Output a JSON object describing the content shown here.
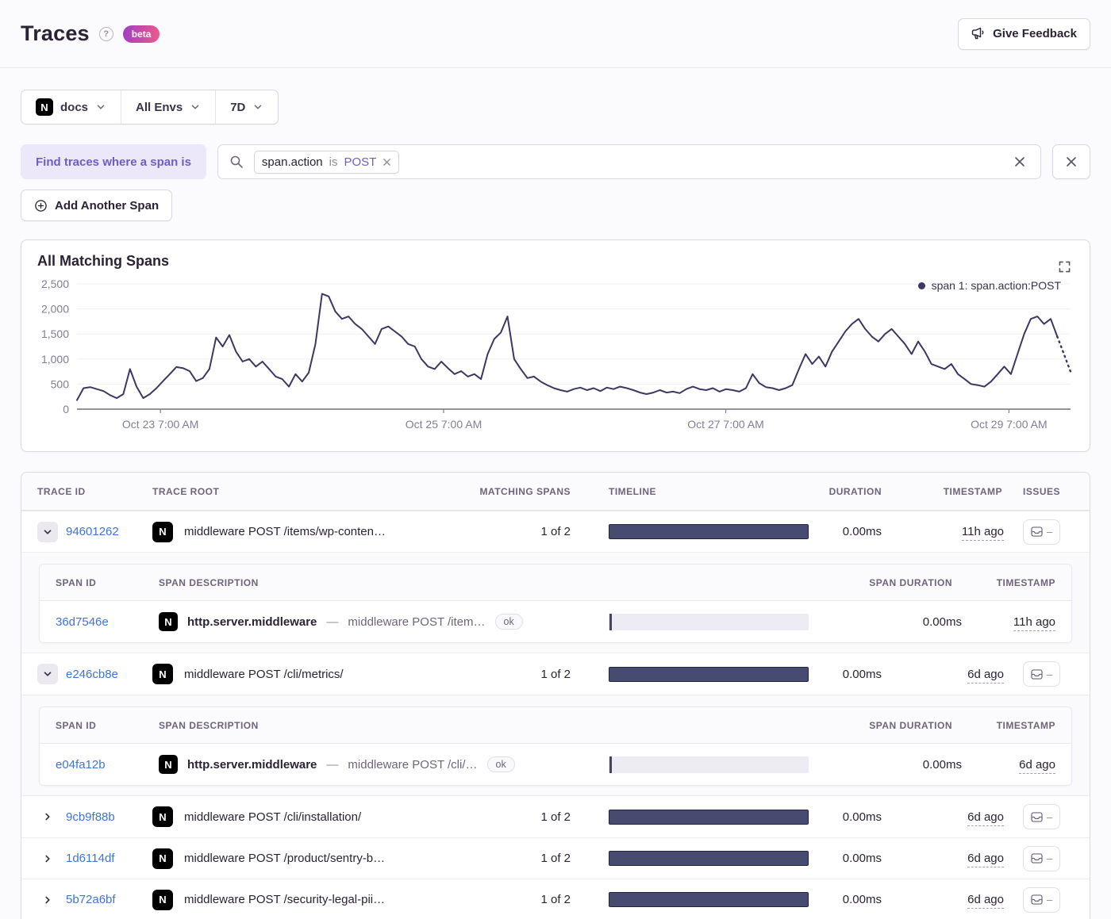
{
  "header": {
    "title": "Traces",
    "beta_label": "beta",
    "feedback_label": "Give Feedback"
  },
  "filters": {
    "project": "docs",
    "environment": "All Envs",
    "date_range": "7D"
  },
  "span_filter": {
    "label": "Find traces where a span is",
    "token_key": "span.action",
    "token_op": "is",
    "token_value": "POST",
    "add_button": "Add Another Span"
  },
  "chart": {
    "title": "All Matching Spans",
    "legend": "span 1: span.action:POST"
  },
  "chart_data": {
    "type": "line",
    "title": "All Matching Spans",
    "legend_position": "top-right",
    "grid": true,
    "line_color": "#3B3861",
    "ylim": [
      0,
      2500
    ],
    "y_ticks": [
      "0",
      "500",
      "1,000",
      "1,500",
      "2,000",
      "2,500"
    ],
    "x_ticks": [
      {
        "label": "Oct 23 7:00 AM",
        "pos": 0.084
      },
      {
        "label": "Oct 25 7:00 AM",
        "pos": 0.369
      },
      {
        "label": "Oct 27 7:00 AM",
        "pos": 0.653
      },
      {
        "label": "Oct 29 7:00 AM",
        "pos": 0.938
      }
    ],
    "dashed_tail_from": 148,
    "series": [
      {
        "name": "span 1: span.action:POST",
        "values": [
          180,
          420,
          440,
          400,
          360,
          280,
          220,
          300,
          800,
          450,
          220,
          300,
          420,
          560,
          700,
          840,
          820,
          760,
          560,
          620,
          800,
          1430,
          1250,
          1480,
          1150,
          950,
          1000,
          850,
          950,
          800,
          650,
          600,
          450,
          700,
          550,
          730,
          1300,
          2300,
          2250,
          1950,
          1800,
          1850,
          1700,
          1600,
          1450,
          1300,
          1600,
          1650,
          1550,
          1450,
          1300,
          1250,
          1000,
          850,
          800,
          950,
          820,
          700,
          760,
          650,
          700,
          600,
          1100,
          1400,
          1530,
          1850,
          1000,
          800,
          620,
          650,
          550,
          480,
          420,
          380,
          350,
          400,
          430,
          380,
          420,
          360,
          430,
          400,
          450,
          420,
          380,
          330,
          300,
          330,
          380,
          330,
          350,
          320,
          400,
          450,
          400,
          380,
          420,
          350,
          400,
          380,
          350,
          420,
          700,
          520,
          440,
          420,
          380,
          420,
          480,
          800,
          1100,
          900,
          1050,
          850,
          1150,
          1350,
          1550,
          1700,
          1800,
          1600,
          1450,
          1350,
          1500,
          1600,
          1450,
          1300,
          1100,
          1350,
          1150,
          900,
          850,
          800,
          900,
          700,
          600,
          500,
          480,
          450,
          550,
          700,
          850,
          700,
          1100,
          1500,
          1800,
          1850,
          1700,
          1800,
          1450,
          1100,
          750
        ]
      }
    ]
  },
  "table": {
    "columns": [
      "TRACE ID",
      "TRACE ROOT",
      "MATCHING SPANS",
      "TIMELINE",
      "DURATION",
      "TIMESTAMP",
      "ISSUES"
    ],
    "span_columns": {
      "id": "SPAN ID",
      "description": "SPAN DESCRIPTION",
      "duration": "SPAN DURATION",
      "timestamp": "TIMESTAMP"
    },
    "rows": [
      {
        "trace_id": "94601262",
        "trace_root": "middleware POST /items/wp-conten…",
        "matching_spans": "1 of 2",
        "duration": "0.00ms",
        "timestamp": "11h ago",
        "issues": "–",
        "expanded": true,
        "spans": [
          {
            "span_id": "36d7546e",
            "op": "http.server.middleware",
            "separator": "—",
            "description": "middleware POST /item…",
            "status": "ok",
            "duration": "0.00ms",
            "timestamp": "11h ago"
          }
        ]
      },
      {
        "trace_id": "e246cb8e",
        "trace_root": "middleware POST /cli/metrics/",
        "matching_spans": "1 of 2",
        "duration": "0.00ms",
        "timestamp": "6d ago",
        "issues": "–",
        "expanded": true,
        "spans": [
          {
            "span_id": "e04fa12b",
            "op": "http.server.middleware",
            "separator": "—",
            "description": "middleware POST /cli/…",
            "status": "ok",
            "duration": "0.00ms",
            "timestamp": "6d ago"
          }
        ]
      },
      {
        "trace_id": "9cb9f88b",
        "trace_root": "middleware POST /cli/installation/",
        "matching_spans": "1 of 2",
        "duration": "0.00ms",
        "timestamp": "6d ago",
        "issues": "–",
        "expanded": false
      },
      {
        "trace_id": "1d6114df",
        "trace_root": "middleware POST /product/sentry-b…",
        "matching_spans": "1 of 2",
        "duration": "0.00ms",
        "timestamp": "6d ago",
        "issues": "–",
        "expanded": false
      },
      {
        "trace_id": "5b72a6bf",
        "trace_root": "middleware POST /security-legal-pii…",
        "matching_spans": "1 of 2",
        "duration": "0.00ms",
        "timestamp": "6d ago",
        "issues": "–",
        "expanded": false
      }
    ]
  },
  "colors": {
    "accent_purple": "#6D5EC8",
    "link_blue": "#3C74DD",
    "chart_line": "#3B3861",
    "timeline_bar_fill": "#484B70",
    "timeline_bar_border": "#23224E",
    "beta_gradient_start": "#A13DC2",
    "beta_gradient_end": "#EE5A8B"
  }
}
